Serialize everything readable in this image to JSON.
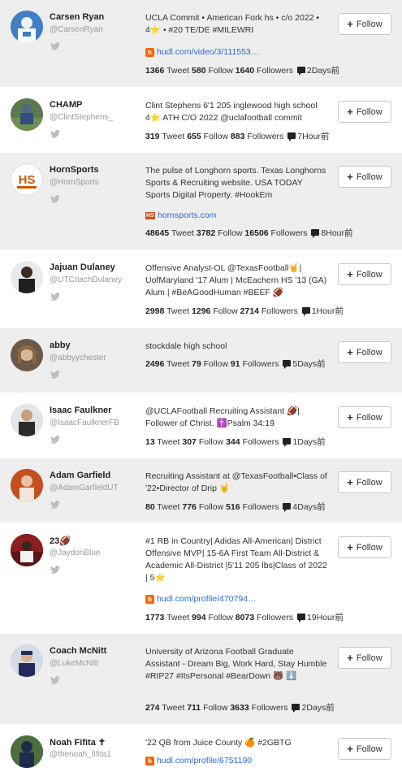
{
  "follow_label": "Follow",
  "labels": {
    "tweet": "Tweet",
    "follow": "Follow",
    "followers": "Followers"
  },
  "colors": {
    "row_shade": "#eeeeee",
    "link": "#2a6ad2",
    "hudl": "#ff6300"
  },
  "users": [
    {
      "name": "Carsen Ryan",
      "handle": "@CarsenRyan",
      "bio": "UCLA Commit • American Fork hs • c/o 2022 • 4⭐ • #20 TE/DE #MILEWRI",
      "link": "hudl.com/video/3/111553…",
      "link_icon": "hudl-icon",
      "tweets": "1366",
      "following": "580",
      "followers": "1640",
      "time": "2Days前"
    },
    {
      "name": "CHAMP",
      "handle": "@ClintStephens_",
      "bio": "Clint Stephens 6'1 205 inglewood high school 4⭐ ATH C/O 2022 @uclafootball commit",
      "link": "",
      "link_icon": "",
      "tweets": "319",
      "following": "655",
      "followers": "883",
      "time": "7Hour前"
    },
    {
      "name": "HornSports",
      "handle": "@HornSports",
      "bio": "The pulse of Longhorn sports. Texas Longhorns Sports & Recruiting website. USA TODAY Sports Digital Property. #HookEm",
      "link": "hornsports.com",
      "link_icon": "hornsports-icon",
      "tweets": "48645",
      "following": "3782",
      "followers": "16506",
      "time": "8Hour前"
    },
    {
      "name": "Jajuan Dulaney",
      "handle": "@UTCoachDulaney",
      "bio": "Offensive Analyst-OL @TexasFootball🤘| UofMaryland '17 Alum | McEachern HS '13 (GA) Alum | #BeAGoodHuman #BEEF 🏈",
      "link": "",
      "link_icon": "",
      "tweets": "2998",
      "following": "1296",
      "followers": "2714",
      "time": "1Hour前"
    },
    {
      "name": "abby",
      "handle": "@abbyychester",
      "bio": "stockdale high school",
      "link": "",
      "link_icon": "",
      "tweets": "2496",
      "following": "79",
      "followers": "91",
      "time": "5Days前"
    },
    {
      "name": "Isaac Faulkner",
      "handle": "@IsaacFaulknerFB",
      "bio": "@UCLAFootball Recruiting Assistant 🏈| Follower of Christ. ✝️Psalm 34:19",
      "link": "",
      "link_icon": "",
      "tweets": "13",
      "following": "307",
      "followers": "344",
      "time": "1Days前"
    },
    {
      "name": "Adam Garfield",
      "handle": "@AdamGarfieldUT",
      "bio": "Recruiting Assistant at @TexasFootball•Class of '22•Director of Drip 🤘",
      "link": "",
      "link_icon": "",
      "tweets": "80",
      "following": "776",
      "followers": "516",
      "time": "4Days前"
    },
    {
      "name": "23🏈",
      "handle": "@JaydonBlue",
      "bio": "#1 RB in Country| Adidas All-American| District Offensive MVP| 15-6A First Team All-District & Academic All-District |5'11 205 lbs|Class of 2022 | 5⭐",
      "link": "hudl.com/profile/470794…",
      "link_icon": "hudl-icon",
      "tweets": "1773",
      "following": "994",
      "followers": "8073",
      "time": "19Hour前"
    },
    {
      "name": "Coach McNitt",
      "handle": "@LukeMcNitt",
      "bio": "University of Arizona Football Graduate Assistant - Dream Big, Work Hard, Stay Humble #RIP27 #ItsPersonal #BearDown 🐻 ⬇️",
      "link": "",
      "link_icon": "",
      "tweets": "274",
      "following": "711",
      "followers": "3633",
      "time": "2Days前"
    },
    {
      "name": "Noah Fifita ✝",
      "handle": "@thenoah_fifita1",
      "bio": "'22 QB from Juice County 🍊 #2GBTG",
      "link": "hudl.com/profile/6751190",
      "link_icon": "hudl-icon",
      "tweets": "",
      "following": "",
      "followers": "",
      "time": ""
    }
  ]
}
